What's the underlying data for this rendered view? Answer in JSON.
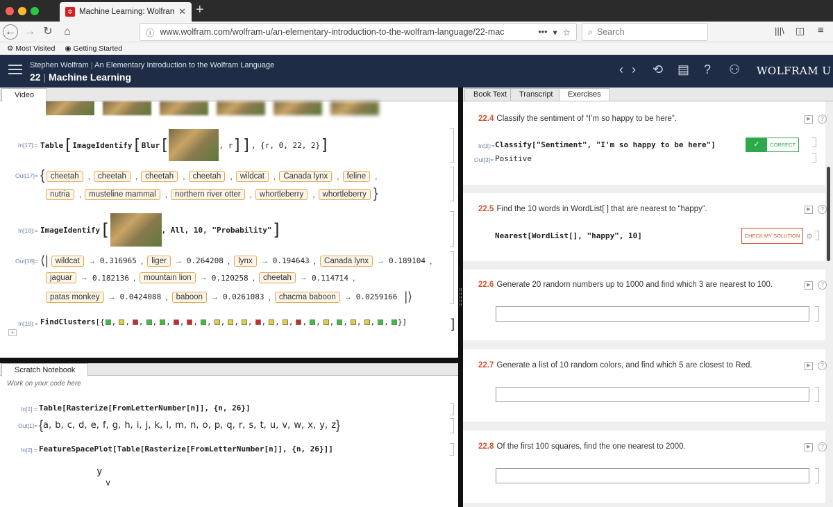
{
  "browser": {
    "tab_title": "Machine Learning: Wolfram Lan",
    "new_tab": "+",
    "url": "www.wolfram.com/wolfram-u/an-elementary-introduction-to-the-wolfram-language/22-mac",
    "url_more": "•••",
    "search_placeholder": "Search",
    "bookmarks": [
      "Most Visited",
      "Getting Started"
    ]
  },
  "header": {
    "author": "Stephen Wolfram",
    "book": "An Elementary Introduction to the Wolfram Language",
    "chapter_num": "22",
    "chapter_title": "Machine Learning",
    "brand": "WOLFRAM U",
    "bg_color": "#1e2d45"
  },
  "left_tabs": [
    "Video"
  ],
  "notebook": {
    "in17_label": "In[17]:=",
    "in17_code_a": "Table",
    "in17_code_b": "ImageIdentify",
    "in17_code_c": "Blur",
    "in17_code_d": ", r",
    "in17_code_e": ", {r, 0, 22, 2}",
    "out17_label": "Out[17]=",
    "out17_row1": [
      "cheetah",
      "cheetah",
      "cheetah",
      "cheetah",
      "wildcat",
      "Canada lynx",
      "feline"
    ],
    "out17_row2": [
      "nutria",
      "musteline mammal",
      "northern river otter",
      "whortleberry",
      "whortleberry"
    ],
    "in18_label": "In[18]:=",
    "in18_code_a": "ImageIdentify",
    "in18_code_b": ", All, 10, \"Probability\"",
    "out18_label": "Out[18]=",
    "out18_rows": [
      [
        {
          "name": "wildcat",
          "value": "0.316965"
        },
        {
          "name": "liger",
          "value": "0.264208"
        },
        {
          "name": "lynx",
          "value": "0.194643"
        },
        {
          "name": "Canada lynx",
          "value": "0.189104"
        }
      ],
      [
        {
          "name": "jaguar",
          "value": "0.182136"
        },
        {
          "name": "mountain lion",
          "value": "0.120258"
        },
        {
          "name": "cheetah",
          "value": "0.114714"
        }
      ],
      [
        {
          "name": "patas monkey",
          "value": "0.0424088"
        },
        {
          "name": "baboon",
          "value": "0.0261083"
        },
        {
          "name": "chacma baboon",
          "value": "0.0259166"
        }
      ]
    ],
    "in19_label": "In[19]:=",
    "in19_code": "FindClusters",
    "swatch_colors": [
      "#3fbf3f",
      "#e0d23a",
      "#cc2a2a",
      "#3fbf3f",
      "#3fbf3f",
      "#cc2a2a",
      "#cc2a2a",
      "#3fbf3f",
      "#e0d23a",
      "#e0d23a",
      "#e0d23a",
      "#cc2a2a",
      "#e0d23a",
      "#e0d23a",
      "#cc2a2a",
      "#3fbf3f",
      "#e0d23a",
      "#3fbf3f",
      "#e0d23a",
      "#e0d23a",
      "#3fbf3f",
      "#3fbf3f"
    ]
  },
  "scratch": {
    "tab": "Scratch Notebook",
    "hint": "Work on your code here",
    "in1_label": "In[1]:=",
    "in1_code": "Table[Rasterize[FromLetterNumber[n]], {n, 26}]",
    "out1_label": "Out[1]=",
    "out1_letters": "a, b, c, d, e, f, g, h, i, j, k, l, m, n, o, p, q, r, s, t, u, v, w, x, y, z",
    "in2_label": "In[2]:=",
    "in2_code": "FeatureSpacePlot[Table[Rasterize[FromLetterNumber[n]], {n, 26}]]",
    "plot_letters": [
      "y",
      "v"
    ]
  },
  "right_tabs": [
    "Book Text",
    "Transcript",
    "Exercises"
  ],
  "exercises": [
    {
      "num": "22.4",
      "question": "Classify the sentiment of “I’m so happy to be here”.",
      "in_label": "In[3]:=",
      "code": "Classify[\"Sentiment\", \"I'm so happy to be here\"]",
      "out_label": "Out[3]=",
      "output": "Positive",
      "status": "CORRECT"
    },
    {
      "num": "22.5",
      "question_a": "Find the 10 words in ",
      "question_b": "WordList[ ]",
      "question_c": " that are nearest to “happy”.",
      "code": "Nearest[WordList[], \"happy\", 10]",
      "button": "CHECK MY SOLUTION"
    },
    {
      "num": "22.6",
      "question": "Generate 20 random numbers up to 1000 and find which 3 are nearest to 100."
    },
    {
      "num": "22.7",
      "question": "Generate a list of 10 random colors, and find which 5 are closest to Red."
    },
    {
      "num": "22.8",
      "question": "Of the first 100 squares, find the one nearest to 2000."
    }
  ]
}
